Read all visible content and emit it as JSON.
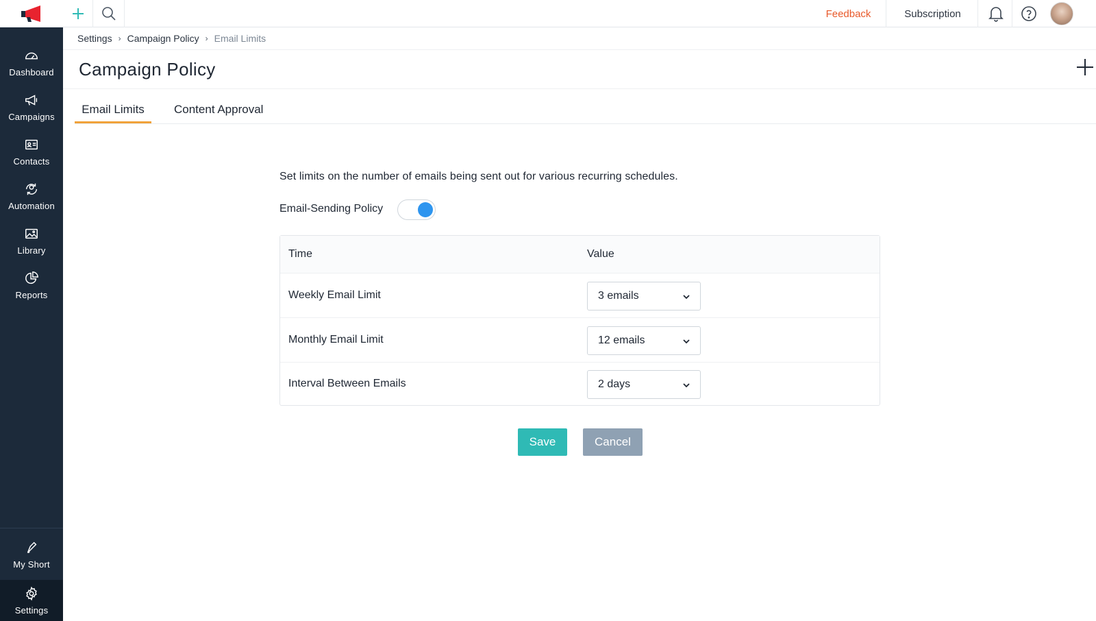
{
  "sidebar": {
    "items": [
      {
        "label": "Dashboard",
        "icon": "dashboard-icon"
      },
      {
        "label": "Campaigns",
        "icon": "megaphone-icon"
      },
      {
        "label": "Contacts",
        "icon": "contact-card-icon"
      },
      {
        "label": "Automation",
        "icon": "automation-icon"
      },
      {
        "label": "Library",
        "icon": "image-icon"
      },
      {
        "label": "Reports",
        "icon": "pie-chart-icon"
      }
    ],
    "bottom": [
      {
        "label": "My Short",
        "icon": "shortcut-icon"
      },
      {
        "label": "Settings",
        "icon": "gear-icon"
      }
    ]
  },
  "topbar": {
    "feedback_label": "Feedback",
    "subscription_label": "Subscription"
  },
  "breadcrumb": {
    "items": [
      "Settings",
      "Campaign Policy",
      "Email Limits"
    ]
  },
  "page": {
    "title": "Campaign Policy"
  },
  "tabs": [
    {
      "label": "Email Limits",
      "active": true
    },
    {
      "label": "Content Approval",
      "active": false
    }
  ],
  "content": {
    "description": "Set limits on the number of emails being sent out for various recurring schedules.",
    "policy_label": "Email-Sending Policy",
    "policy_enabled": true,
    "table": {
      "headers": [
        "Time",
        "Value"
      ],
      "rows": [
        {
          "label": "Weekly Email Limit",
          "value": "3 emails"
        },
        {
          "label": "Monthly Email Limit",
          "value": "12 emails"
        },
        {
          "label": "Interval Between Emails",
          "value": "2 days"
        }
      ]
    },
    "save_label": "Save",
    "cancel_label": "Cancel"
  },
  "colors": {
    "sidebar_bg": "#1c2a3a",
    "accent_teal": "#2fbab5",
    "tab_underline": "#f0a23a",
    "feedback": "#e8592a",
    "toggle_on": "#2e95ef"
  }
}
